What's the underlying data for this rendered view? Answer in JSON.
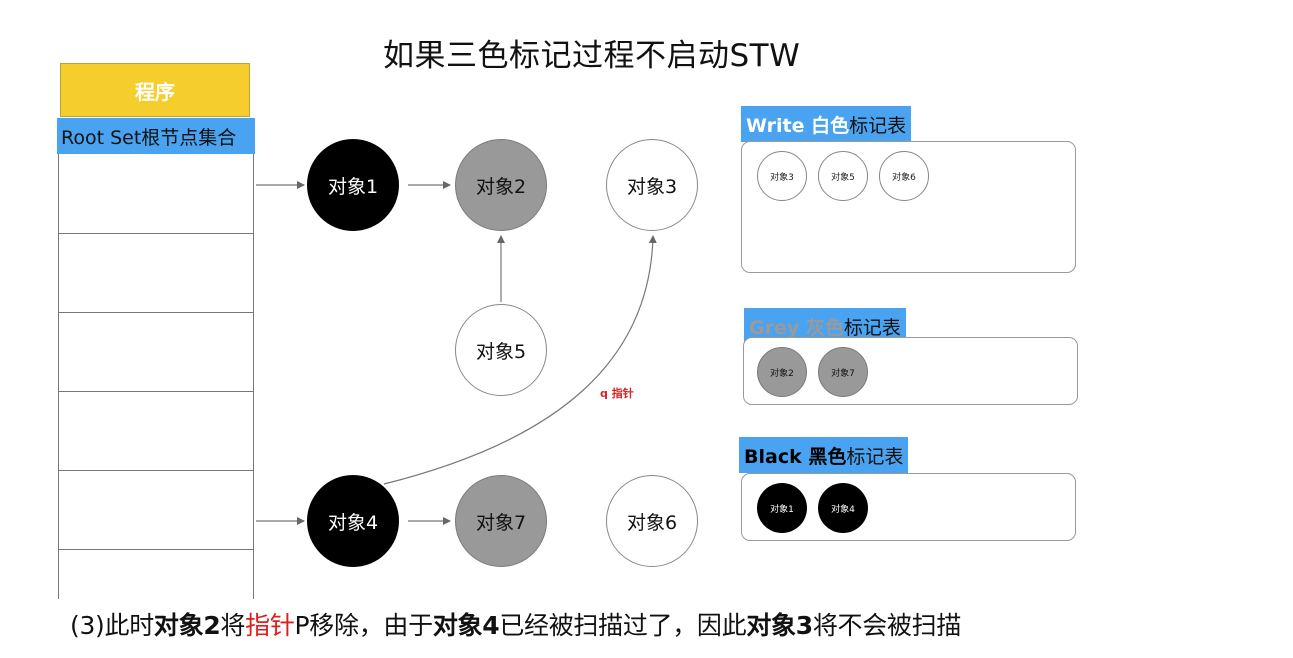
{
  "title": "如果三色标记过程不启动STW",
  "program_label": "程序",
  "root_set_label": "Root Set根节点集合",
  "nodes": {
    "n1": "对象1",
    "n2": "对象2",
    "n3": "对象3",
    "n4": "对象4",
    "n5": "对象5",
    "n6": "对象6",
    "n7": "对象7"
  },
  "q_pointer_label": "q 指针",
  "tables": {
    "white": {
      "head_en": "Write 白色",
      "head_cn": "标记表",
      "color": "#ffffff",
      "items": [
        "对象3",
        "对象5",
        "对象6"
      ]
    },
    "grey": {
      "head_en": "Grey 灰色",
      "head_cn": "标记表",
      "color": "#999999",
      "items": [
        "对象2",
        "对象7"
      ]
    },
    "black": {
      "head_en": "Black 黑色",
      "head_cn": "标记表",
      "color": "#000000",
      "items": [
        "对象1",
        "对象4"
      ]
    }
  },
  "caption": {
    "p1": "(3)此时",
    "p2": "对象2",
    "p3": "将",
    "p4": "指针",
    "p5": "P移除，由于",
    "p6": "对象4",
    "p7": "已经被扫描过了，因此",
    "p8": "对象3",
    "p9": "将不会被扫描"
  },
  "colors": {
    "accent_blue": "#4aa3f0",
    "program_yellow": "#f5cd2c",
    "pointer_red": "#e21b1b"
  }
}
